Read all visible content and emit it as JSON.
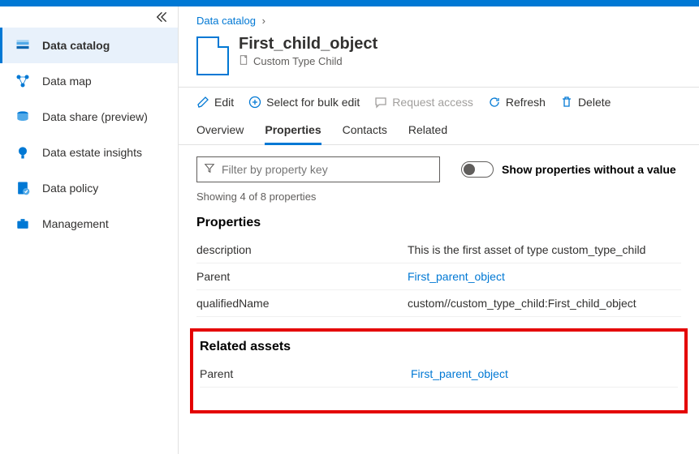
{
  "sidebar": {
    "items": [
      {
        "label": "Data catalog"
      },
      {
        "label": "Data map"
      },
      {
        "label": "Data share (preview)"
      },
      {
        "label": "Data estate insights"
      },
      {
        "label": "Data policy"
      },
      {
        "label": "Management"
      }
    ]
  },
  "breadcrumb": {
    "root": "Data catalog"
  },
  "asset": {
    "title": "First_child_object",
    "type_label": "Custom Type Child"
  },
  "toolbar": {
    "edit": "Edit",
    "select_bulk": "Select for bulk edit",
    "request_access": "Request access",
    "refresh": "Refresh",
    "delete": "Delete"
  },
  "tabs": {
    "overview": "Overview",
    "properties": "Properties",
    "contacts": "Contacts",
    "related": "Related"
  },
  "filter": {
    "placeholder": "Filter by property key"
  },
  "toggle_label": "Show properties without a value",
  "showing_text": "Showing 4 of 8 properties",
  "properties_header": "Properties",
  "properties": [
    {
      "key": "description",
      "value": "This is the first asset of type custom_type_child",
      "link": false
    },
    {
      "key": "Parent",
      "value": "First_parent_object",
      "link": true
    },
    {
      "key": "qualifiedName",
      "value": "custom//custom_type_child:First_child_object",
      "link": false
    }
  ],
  "related_header": "Related assets",
  "related": [
    {
      "key": "Parent",
      "value": "First_parent_object",
      "link": true
    }
  ]
}
